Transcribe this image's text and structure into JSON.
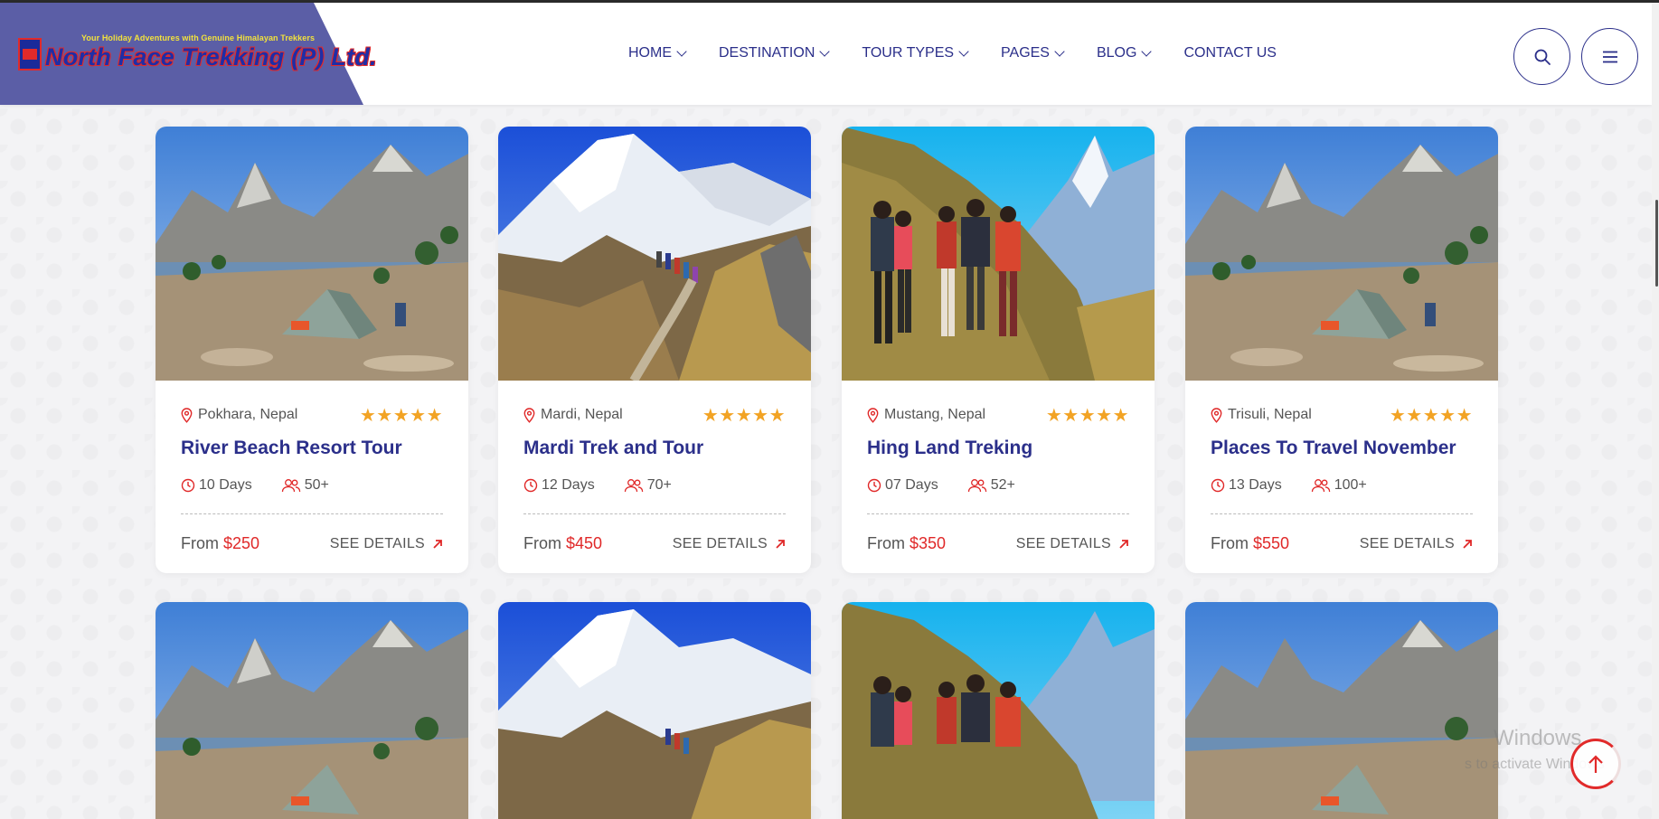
{
  "brand": {
    "tagline": "Your Holiday Adventures with Genuine Himalayan Trekkers",
    "name": "North Face Trekking (P) Ltd."
  },
  "nav": {
    "home": "HOME",
    "destination": "DESTINATION",
    "tour_types": "TOUR TYPES",
    "pages": "PAGES",
    "blog": "BLOG",
    "contact": "CONTACT US"
  },
  "tours": [
    {
      "location": "Pokhara, Nepal",
      "rating": "★★★★★",
      "title": "River Beach Resort Tour",
      "duration": "10 Days",
      "people": "50+",
      "from_label": "From",
      "price": "$250",
      "details": "SEE DETAILS",
      "image": "tent-lake"
    },
    {
      "location": "Mardi, Nepal",
      "rating": "★★★★★",
      "title": "Mardi Trek and Tour",
      "duration": "12 Days",
      "people": "70+",
      "from_label": "From",
      "price": "$450",
      "details": "SEE DETAILS",
      "image": "snow-peak"
    },
    {
      "location": "Mustang, Nepal",
      "rating": "★★★★★",
      "title": "Hing Land Treking",
      "duration": "07 Days",
      "people": "52+",
      "from_label": "From",
      "price": "$350",
      "details": "SEE DETAILS",
      "image": "trekkers"
    },
    {
      "location": "Trisuli, Nepal",
      "rating": "★★★★★",
      "title": "Places To Travel November",
      "duration": "13 Days",
      "people": "100+",
      "from_label": "From",
      "price": "$550",
      "details": "SEE DETAILS",
      "image": "tent-lake"
    }
  ],
  "overlay": {
    "watermark_title": "Windows",
    "watermark_sub": "s to activate Windows"
  },
  "colors": {
    "accent": "#2b2f8a",
    "price": "#e02828",
    "star": "#f2a324",
    "logo_panel": "#5b5ea6"
  }
}
